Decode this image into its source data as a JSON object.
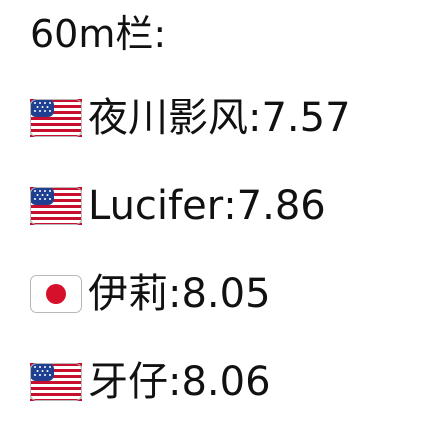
{
  "header": {
    "title": "60m栏:"
  },
  "results": [
    {
      "flag": "us-flag-icon",
      "name": "夜川影风",
      "separator": ":",
      "time": "7.57"
    },
    {
      "flag": "us-flag-icon",
      "name": "Lucifer",
      "separator": ":",
      "time": "7.86"
    },
    {
      "flag": "jp-flag-icon",
      "name": "伊莉",
      "separator": ":",
      "time": "8.05"
    },
    {
      "flag": "us-flag-icon",
      "name": "牙仔",
      "separator": ":",
      "time": "8.06"
    }
  ],
  "colors": {
    "text": "#111111",
    "us_red": "#c8102e",
    "us_blue": "#1f3f91",
    "jp_red": "#d60f2a",
    "flag_border": "#b8b8b8"
  }
}
